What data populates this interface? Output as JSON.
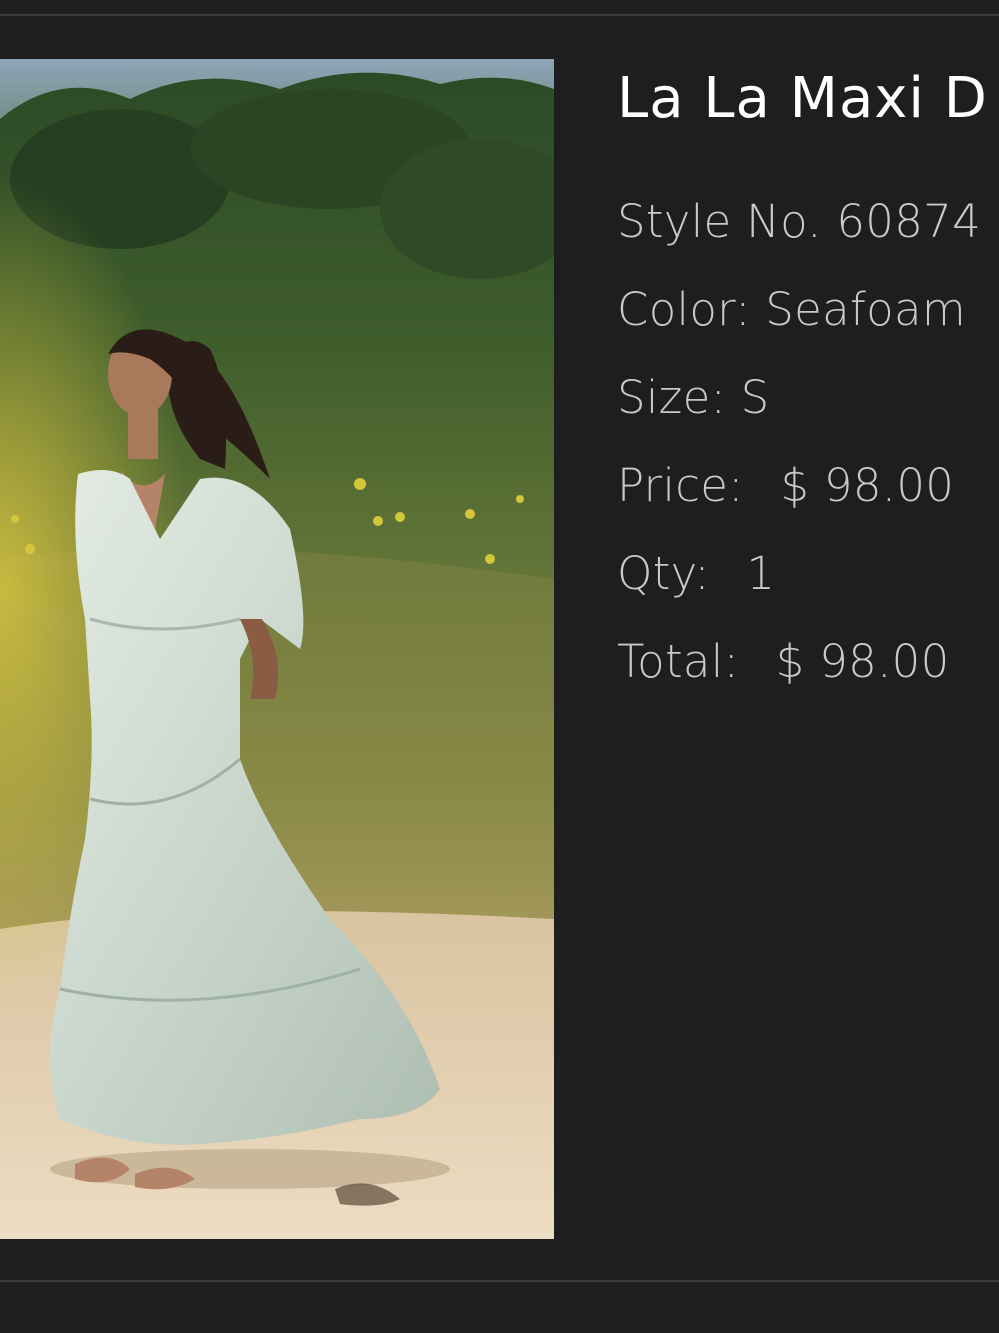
{
  "product": {
    "title": "La La Maxi D",
    "image_icon": "product-photo-icon",
    "style_label": "Style No.",
    "style_value": "60874",
    "color_label": "Color:",
    "color_value": "Seafoam",
    "size_label": "Size:",
    "size_value": "S",
    "price_label": "Price:",
    "price_value": "$ 98.00",
    "qty_label": "Qty:",
    "qty_value": "1",
    "total_label": "Total:",
    "total_value": "$ 98.00"
  },
  "colors": {
    "background": "#1e1d1f",
    "divider": "#3a393b",
    "title_text": "#ffffff",
    "info_text": "#c9c8ca"
  }
}
